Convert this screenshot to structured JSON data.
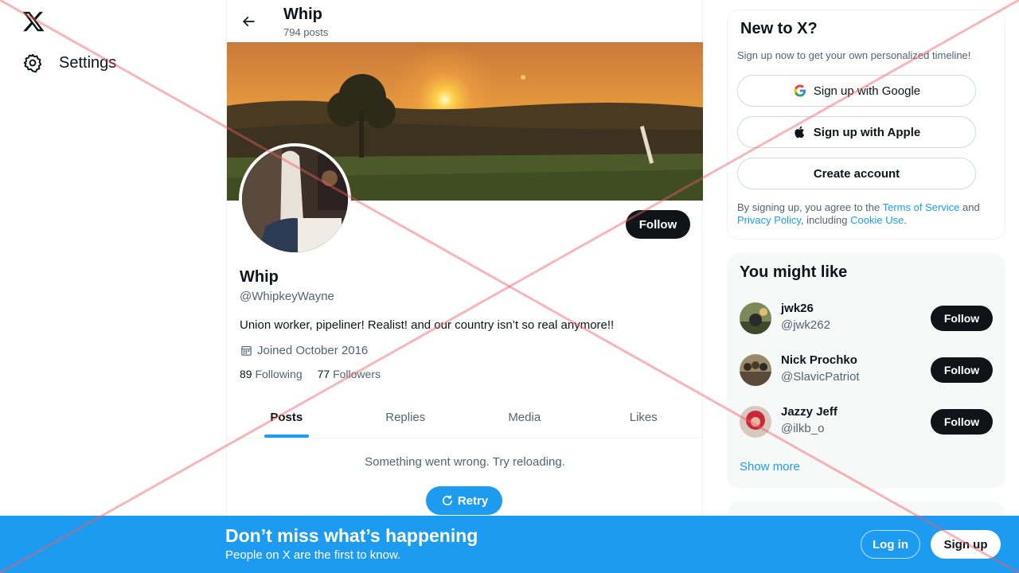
{
  "nav": {
    "settings_label": "Settings"
  },
  "header": {
    "name": "Whip",
    "posts": "794 posts"
  },
  "profile": {
    "name": "Whip",
    "handle": "@WhipkeyWayne",
    "bio": "Union worker, pipeliner! Realist! and our country isn’t so real anymore!!",
    "joined": "Joined October 2016",
    "following_count": "89",
    "following_label": " Following",
    "followers_count": "77",
    "followers_label": " Followers",
    "follow_label": "Follow"
  },
  "tabs": [
    {
      "label": "Posts"
    },
    {
      "label": "Replies"
    },
    {
      "label": "Media"
    },
    {
      "label": "Likes"
    }
  ],
  "feed": {
    "error": "Something went wrong. Try reloading.",
    "retry": "Retry"
  },
  "new_to_x": {
    "title": "New to X?",
    "subtitle": "Sign up now to get your own personalized timeline!",
    "google": "Sign up with Google",
    "apple": "Sign up with Apple",
    "create": "Create account",
    "legal_pre": "By signing up, you agree to the ",
    "terms": "Terms of Service",
    "legal_and": " and ",
    "privacy": "Privacy Policy",
    "legal_incl": ", including ",
    "cookie": "Cookie Use",
    "legal_end": "."
  },
  "you_might_like": {
    "title": "You might like",
    "items": [
      {
        "name": "jwk26",
        "handle": "@jwk262",
        "follow": "Follow"
      },
      {
        "name": "Nick Prochko",
        "handle": "@SlavicPatriot",
        "follow": "Follow"
      },
      {
        "name": "Jazzy Jeff",
        "handle": "@ilkb_o",
        "follow": "Follow"
      }
    ],
    "show_more": "Show more"
  },
  "bottom_bar": {
    "title": "Don’t miss what’s happening",
    "subtitle": "People on X are the first to know.",
    "login": "Log in",
    "signup": "Sign up"
  },
  "colors": {
    "accent": "#1d9bf0",
    "text": "#0f1419",
    "secondary": "#536471"
  },
  "icons": [
    "x-logo-icon",
    "gear-icon",
    "back-arrow-icon",
    "calendar-icon",
    "retry-icon",
    "google-icon",
    "apple-icon"
  ]
}
